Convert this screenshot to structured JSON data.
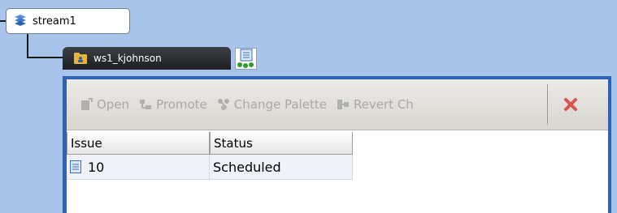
{
  "stream": {
    "name": "stream1"
  },
  "workspace": {
    "name": "ws1_kjohnson"
  },
  "toolbar": {
    "open": "Open",
    "promote": "Promote",
    "change_palette": "Change Palette",
    "revert": "Revert Ch"
  },
  "grid": {
    "headers": [
      "Issue",
      "Status"
    ],
    "rows": [
      {
        "issue": "10",
        "status": "Scheduled"
      }
    ]
  },
  "colors": {
    "background": "#a9c4ea",
    "panel_border": "#2c63b6",
    "ws_node": "#2b2d31",
    "close": "#d9534f"
  },
  "icons": {
    "stream": "stream-icon",
    "workspace": "workspace-folder-icon",
    "badge": "issue-tree-icon",
    "open": "open-icon",
    "promote": "promote-icon",
    "change_palette": "change-palette-icon",
    "revert": "revert-icon",
    "close": "close-icon",
    "issue": "issue-document-icon"
  }
}
